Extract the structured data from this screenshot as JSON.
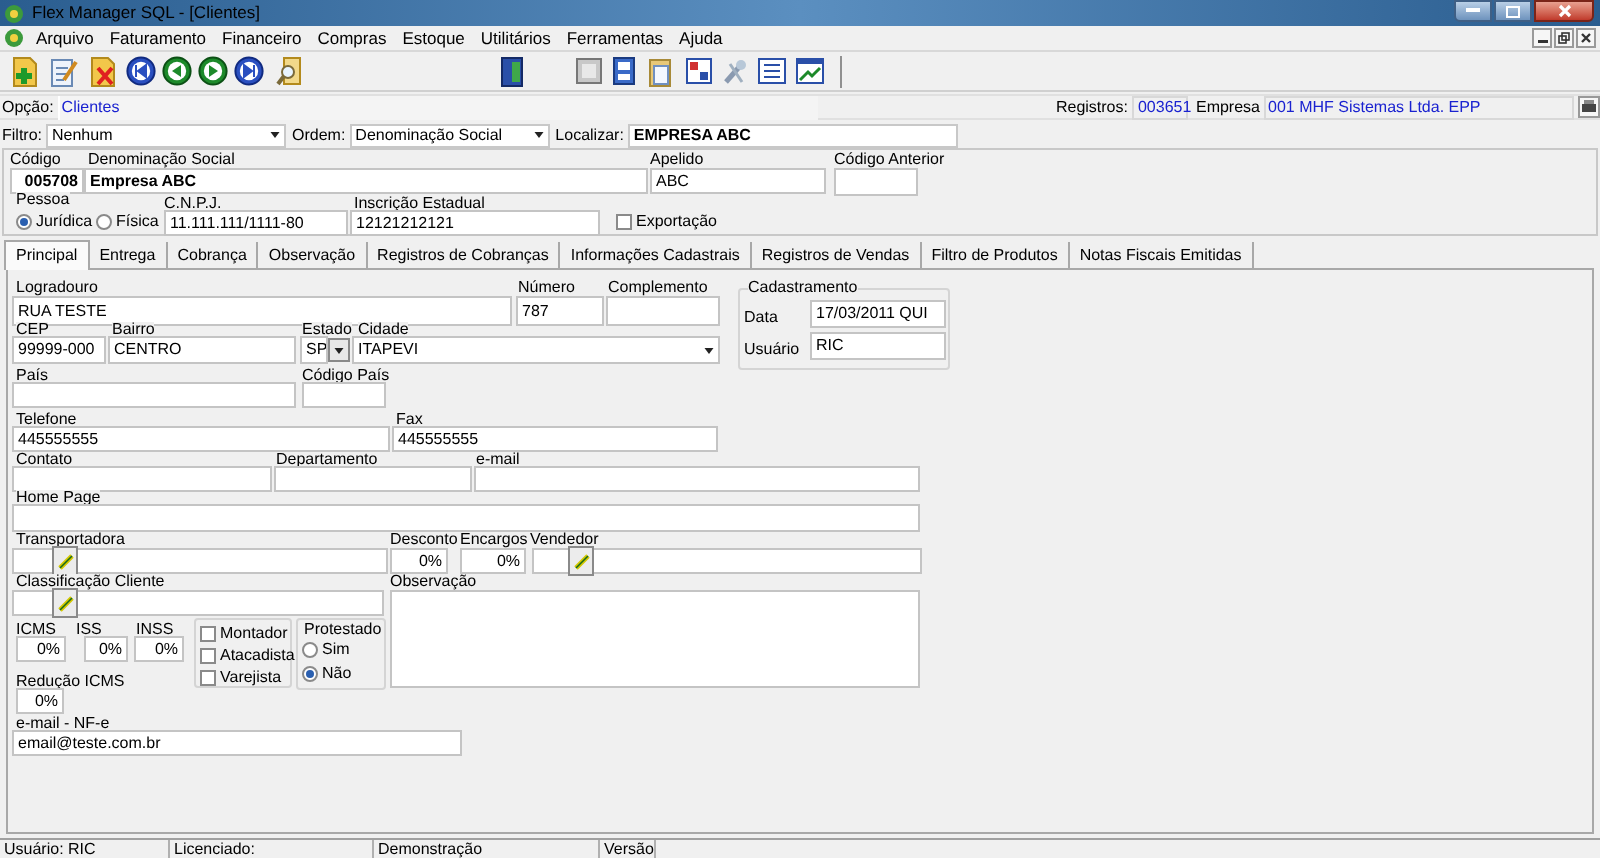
{
  "window": {
    "title": "Flex Manager SQL - [Clientes]"
  },
  "menu": [
    "Arquivo",
    "Faturamento",
    "Financeiro",
    "Compras",
    "Estoque",
    "Utilitários",
    "Ferramentas",
    "Ajuda"
  ],
  "option": {
    "label": "Opção:",
    "value": "Clientes"
  },
  "records": {
    "label": "Registros:",
    "value": "003651"
  },
  "company": {
    "label": "Empresa",
    "value": "001 MHF Sistemas Ltda. EPP"
  },
  "filter_bar": [
    {
      "label": "Filtro:",
      "value": "Nenhum",
      "kind": "combo"
    },
    {
      "label": "Ordem:",
      "value": "Denominação Social",
      "kind": "combo"
    },
    {
      "label": "Localizar:",
      "value": "EMPRESA ABC",
      "kind": "text"
    }
  ],
  "header_fields": [
    {
      "label": "Código",
      "value": "005708",
      "kind": "text"
    },
    {
      "label": "Denominação Social",
      "value": "Empresa ABC",
      "kind": "text"
    },
    {
      "label": "Apelido",
      "value": "ABC",
      "kind": "text"
    },
    {
      "label": "Código Anterior",
      "kind": "text"
    },
    {
      "label": "Pessoa",
      "kind": "radio_group",
      "options": [
        {
          "label": "Jurídica",
          "selected": true
        },
        {
          "label": "Física",
          "selected": false
        }
      ]
    },
    {
      "label": "C.N.P.J.",
      "value": "11.111.111/1111-80",
      "kind": "text"
    },
    {
      "label": "Inscrição Estadual",
      "value": "12121212121",
      "kind": "text"
    },
    {
      "label": "Exportação",
      "kind": "check",
      "checked": false
    }
  ],
  "tabs": [
    {
      "label": "Principal",
      "selected": true
    },
    {
      "label": "Entrega",
      "selected": false
    },
    {
      "label": "Cobrança",
      "selected": false
    },
    {
      "label": "Observação",
      "selected": false
    },
    {
      "label": "Registros de Cobranças",
      "selected": false
    },
    {
      "label": "Informações Cadastrais",
      "selected": false
    },
    {
      "label": "Registros de Vendas",
      "selected": false
    },
    {
      "label": "Filtro de Produtos",
      "selected": false
    },
    {
      "label": "Notas Fiscais Emitidas",
      "selected": false
    }
  ],
  "principal_fields": [
    {
      "label": "Logradouro",
      "value": "RUA TESTE",
      "kind": "text"
    },
    {
      "label": "Número",
      "value": "787",
      "kind": "text"
    },
    {
      "label": "Complemento",
      "kind": "text"
    },
    {
      "label": "CEP",
      "value": "99999-000",
      "kind": "text"
    },
    {
      "label": "Bairro",
      "value": "CENTRO",
      "kind": "text"
    },
    {
      "label": "Estado",
      "value": "SP",
      "kind": "combo"
    },
    {
      "label": "Cidade",
      "value": "ITAPEVI",
      "kind": "combo"
    },
    {
      "label": "Cadastramento",
      "kind": "group",
      "children": [
        {
          "label": "Data",
          "value": "17/03/2011 QUI",
          "kind": "text"
        },
        {
          "label": "Usuário",
          "value": "RIC",
          "kind": "text"
        }
      ]
    },
    {
      "label": "País",
      "kind": "text"
    },
    {
      "label": "Código País",
      "kind": "text"
    },
    {
      "label": "Telefone",
      "value": "445555555",
      "kind": "text"
    },
    {
      "label": "Fax",
      "value": "445555555",
      "kind": "text"
    },
    {
      "label": "Contato",
      "kind": "text"
    },
    {
      "label": "Departamento",
      "kind": "text"
    },
    {
      "label": "e-mail",
      "kind": "text"
    },
    {
      "label": "Home Page",
      "kind": "text"
    },
    {
      "label": "Transportadora",
      "kind": "lookup"
    },
    {
      "label": "Desconto",
      "value": "0%",
      "kind": "text"
    },
    {
      "label": "Encargos",
      "value": "0%",
      "kind": "text"
    },
    {
      "label": "Vendedor",
      "kind": "lookup"
    },
    {
      "label": "Classificação Cliente",
      "kind": "lookup"
    },
    {
      "label": "Observação",
      "kind": "memo"
    },
    {
      "label": "ICMS",
      "value": "0%",
      "kind": "text"
    },
    {
      "label": "ISS",
      "value": "0%",
      "kind": "text"
    },
    {
      "label": "INSS",
      "value": "0%",
      "kind": "text"
    },
    {
      "kind": "group",
      "children": [
        {
          "label": "Montador",
          "kind": "check",
          "checked": false
        },
        {
          "label": "Atacadista",
          "kind": "check",
          "checked": false
        },
        {
          "label": "Varejista",
          "kind": "check",
          "checked": false
        }
      ]
    },
    {
      "label": "Protestado",
      "kind": "radio_group",
      "options": [
        {
          "label": "Sim",
          "selected": false
        },
        {
          "label": "Não",
          "selected": true
        }
      ]
    },
    {
      "label": "Redução ICMS",
      "value": "0%",
      "kind": "text"
    },
    {
      "label": "e-mail - NF-e",
      "value": "email@teste.com.br",
      "kind": "text"
    }
  ],
  "status_bar": [
    "Usuário: RIC",
    "Licenciado:",
    "Demonstração",
    "Versão"
  ]
}
